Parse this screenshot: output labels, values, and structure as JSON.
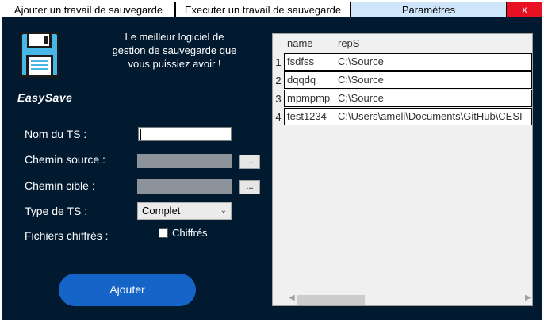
{
  "tabs": [
    {
      "label": "Ajouter un travail de sauvegarde"
    },
    {
      "label": "Executer un travail de sauvegarde"
    },
    {
      "label": "Paramètres"
    }
  ],
  "close_label": "x",
  "brand": "EasySave",
  "slogan": {
    "line1": "Le meilleur logiciel de",
    "line2": "gestion de sauvegarde que",
    "line3": "vous puissiez avoir !"
  },
  "form": {
    "name_label": "Nom du TS :",
    "name_value": "",
    "source_label": "Chemin source :",
    "target_label": "Chemin cible :",
    "browse_label": "...",
    "type_label": "Type de TS :",
    "type_value": "Complet",
    "encrypted_label": "Fichiers chiffrés :",
    "encrypted_checkbox_label": "Chiffrés",
    "add_label": "Ajouter"
  },
  "grid": {
    "columns": [
      "name",
      "repS"
    ],
    "rows": [
      {
        "num": "1",
        "name": "fsdfss",
        "repS": "C:\\Source"
      },
      {
        "num": "2",
        "name": "dqqdq",
        "repS": "C:\\Source"
      },
      {
        "num": "3",
        "name": "mpmpmp",
        "repS": "C:\\Source"
      },
      {
        "num": "4",
        "name": "test1234",
        "repS": "C:\\Users\\ameli\\Documents\\GitHub\\CESI"
      }
    ]
  },
  "colors": {
    "panel_bg": "#021a30",
    "add_button": "#1565c8",
    "close_button": "#e81123",
    "active_tab": "#cfe5f9"
  }
}
